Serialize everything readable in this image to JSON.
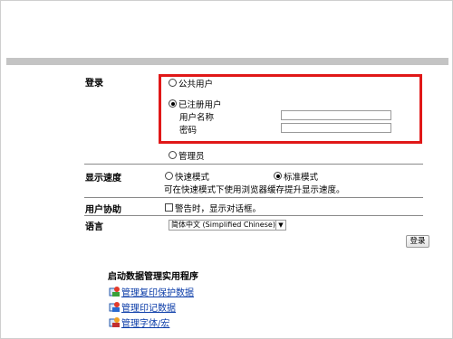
{
  "login": {
    "label": "登录",
    "public_user": "公共用户",
    "registered_user": "已注册用户",
    "username_label": "用户名称",
    "password_label": "密码",
    "admin": "管理员",
    "selected": "registered_user",
    "username_value": "",
    "password_value": ""
  },
  "display_speed": {
    "label": "显示速度",
    "quick_mode": "快速模式",
    "standard_mode": "标准模式",
    "selected": "standard",
    "note": "可在快速模式下使用浏览器缓存提升显示速度。"
  },
  "user_assist": {
    "label": "用户协助",
    "checkbox_label": "警告时，显示对话框。",
    "checked": false
  },
  "language": {
    "label": "语言",
    "selected": "简体中文 (Simplified Chinese)"
  },
  "login_button": "登录",
  "utilities": {
    "title": "启动数据管理实用程序",
    "links": [
      {
        "label": "管理复印保护数据",
        "icon": "copy-protect-icon"
      },
      {
        "label": "管理印记数据",
        "icon": "stamp-data-icon"
      },
      {
        "label": "管理字体/宏",
        "icon": "font-macro-icon"
      }
    ]
  },
  "colors": {
    "highlight_border": "#e01818",
    "link": "#0b3ca8",
    "header_bar": "#c4c4c4"
  }
}
